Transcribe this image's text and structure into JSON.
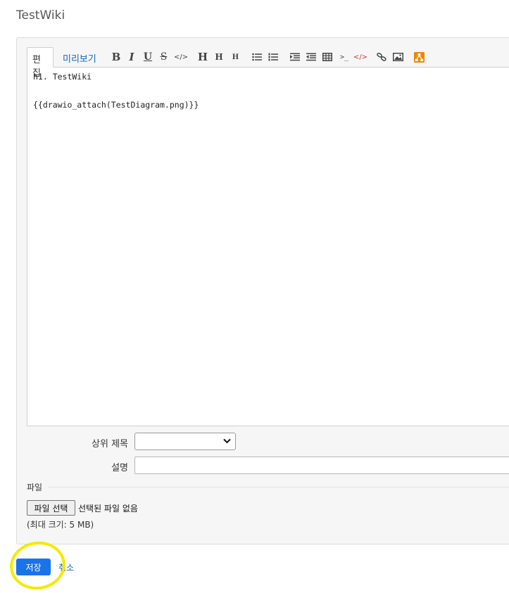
{
  "page": {
    "title": "TestWiki"
  },
  "toolbar": {
    "tabs": {
      "edit": "편집",
      "preview": "미리보기"
    },
    "buttons": [
      {
        "name": "bold",
        "glyph": "B"
      },
      {
        "name": "italic",
        "glyph": "I"
      },
      {
        "name": "underline",
        "glyph": "U"
      },
      {
        "name": "strikethrough",
        "glyph": "S"
      },
      {
        "name": "inline-code",
        "glyph": "</>"
      },
      {
        "name": "heading-1",
        "glyph": "H"
      },
      {
        "name": "heading-2",
        "glyph": "H"
      },
      {
        "name": "heading-3",
        "glyph": "H"
      },
      {
        "name": "unordered-list",
        "glyph": "ul-icon"
      },
      {
        "name": "ordered-list",
        "glyph": "ol-icon"
      },
      {
        "name": "indent",
        "glyph": "indent-icon"
      },
      {
        "name": "outdent",
        "glyph": "outdent-icon"
      },
      {
        "name": "table",
        "glyph": "table-icon"
      },
      {
        "name": "preformatted",
        "glyph": ">_"
      },
      {
        "name": "highlighted-code",
        "glyph": "</>"
      },
      {
        "name": "link",
        "glyph": "link-icon"
      },
      {
        "name": "image",
        "glyph": "image-icon"
      },
      {
        "name": "drawio",
        "glyph": "drawio-icon"
      }
    ],
    "highlighted_code_color": "#d9302c",
    "drawio_color": "#f08705"
  },
  "editor": {
    "lines": [
      "h1. TestWiki",
      "",
      "{{drawio_attach(TestDiagram.png)}}"
    ],
    "highlight_color": "#ffea00"
  },
  "form": {
    "parent_title_label": "상위 제목",
    "parent_title_value": "",
    "description_label": "설명",
    "description_value": ""
  },
  "files": {
    "legend": "파일",
    "choose_button": "파일 선택",
    "status": "선택된 파일 없음",
    "max_size": "(최대 크기: 5 MB)"
  },
  "actions": {
    "save": "저장",
    "cancel": "취소",
    "save_color": "#1a73e8"
  },
  "annotation": {
    "circle_color": "#f4ea00"
  }
}
